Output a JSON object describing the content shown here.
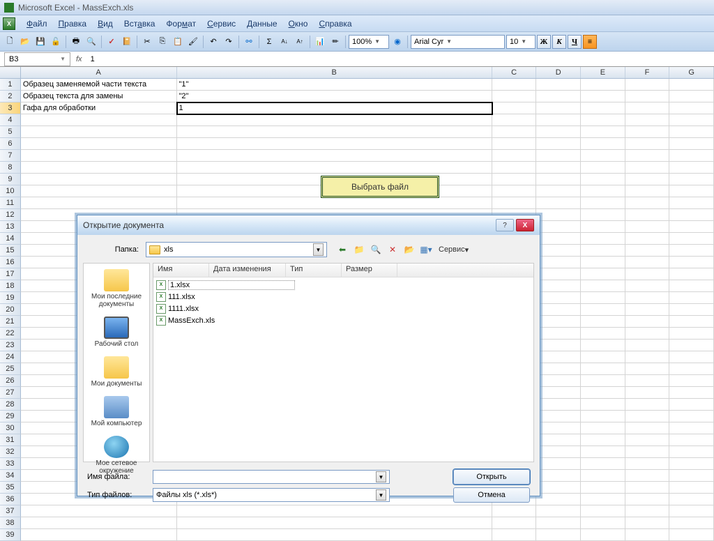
{
  "titlebar": {
    "text": "Microsoft Excel - MassExch.xls"
  },
  "menubar": {
    "items": [
      {
        "label": "Файл",
        "u": "Ф"
      },
      {
        "label": "Правка",
        "u": "П"
      },
      {
        "label": "Вид",
        "u": "В"
      },
      {
        "label": "Вставка",
        "u": "В"
      },
      {
        "label": "Формат",
        "u": "Ф"
      },
      {
        "label": "Сервис",
        "u": "С"
      },
      {
        "label": "Данные",
        "u": "Д"
      },
      {
        "label": "Окно",
        "u": "О"
      },
      {
        "label": "Справка",
        "u": "С"
      }
    ]
  },
  "toolbar": {
    "zoom": "100%",
    "font": "Arial Cyr",
    "size": "10",
    "bold": "Ж",
    "italic": "К",
    "underline": "Ч"
  },
  "formulabar": {
    "cellref": "B3",
    "fx": "fx",
    "value": "1"
  },
  "columns": [
    "A",
    "B",
    "C",
    "D",
    "E",
    "F",
    "G"
  ],
  "cells": {
    "A1": "Образец заменяемой части текста",
    "B1": "\"1\"",
    "A2": "Образец текста для замены",
    "B2": "\"2\"",
    "A3": "Гафа для обработки",
    "B3": "1"
  },
  "sheet_button": {
    "label": "Выбрать файл"
  },
  "dialog": {
    "title": "Открытие документа",
    "folder_label": "Папка:",
    "folder_value": "xls",
    "service": "Сервис",
    "places": {
      "recent": "Мои последние документы",
      "desktop": "Рабочий стол",
      "docs": "Мои документы",
      "computer": "Мой компьютер",
      "network": "Мое сетевое окружение"
    },
    "columns": {
      "name": "Имя",
      "date": "Дата изменения",
      "type": "Тип",
      "size": "Размер"
    },
    "files": [
      "1.xlsx",
      "111.xlsx",
      "1111.xlsx",
      "MassExch.xls"
    ],
    "filename_label": "Имя файла:",
    "filename_value": "",
    "filetype_label": "Тип файлов:",
    "filetype_value": "Файлы xls (*.xls*)",
    "open": "Открыть",
    "cancel": "Отмена",
    "help": "?",
    "close": "X"
  }
}
